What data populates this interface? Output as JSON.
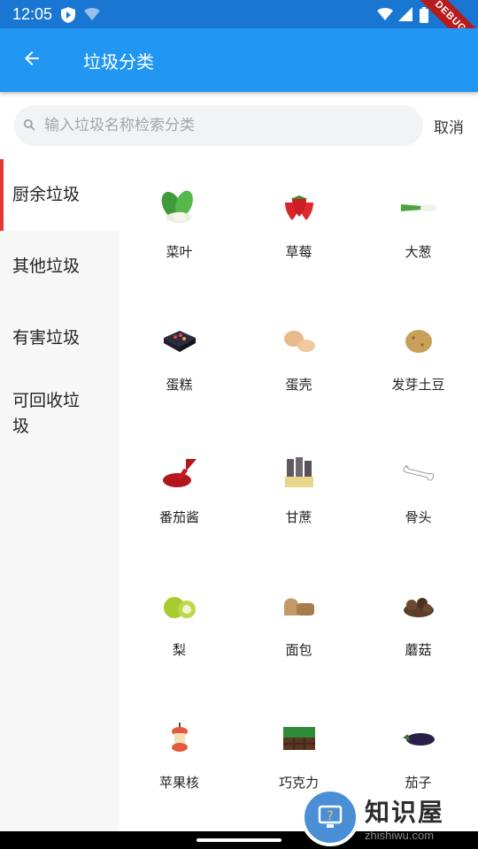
{
  "status_bar": {
    "time": "12:05",
    "debug_label": "DEBUG"
  },
  "app_bar": {
    "title": "垃圾分类"
  },
  "search": {
    "placeholder": "输入垃圾名称检索分类",
    "cancel_label": "取消"
  },
  "sidebar": {
    "items": [
      {
        "label": "厨余垃圾",
        "active": true
      },
      {
        "label": "其他垃圾",
        "active": false
      },
      {
        "label": "有害垃圾",
        "active": false
      },
      {
        "label": "可回收垃圾",
        "active": false
      }
    ]
  },
  "grid": {
    "items": [
      {
        "label": "菜叶",
        "icon": "vegetable-leaf-icon"
      },
      {
        "label": "草莓",
        "icon": "strawberry-icon"
      },
      {
        "label": "大葱",
        "icon": "scallion-icon"
      },
      {
        "label": "蛋糕",
        "icon": "cake-icon"
      },
      {
        "label": "蛋壳",
        "icon": "eggshell-icon"
      },
      {
        "label": "发芽土豆",
        "icon": "sprouted-potato-icon"
      },
      {
        "label": "番茄酱",
        "icon": "ketchup-icon"
      },
      {
        "label": "甘蔗",
        "icon": "sugarcane-icon"
      },
      {
        "label": "骨头",
        "icon": "bone-icon"
      },
      {
        "label": "梨",
        "icon": "pear-icon"
      },
      {
        "label": "面包",
        "icon": "bread-icon"
      },
      {
        "label": "蘑菇",
        "icon": "mushroom-icon"
      },
      {
        "label": "苹果核",
        "icon": "apple-core-icon"
      },
      {
        "label": "巧克力",
        "icon": "chocolate-icon"
      },
      {
        "label": "茄子",
        "icon": "eggplant-icon"
      }
    ]
  },
  "watermark": {
    "title": "知识屋",
    "subtitle": "zhishiwu.com"
  },
  "colors": {
    "status_bar": "#1976d2",
    "app_bar": "#2196f3",
    "active_indicator": "#e53935"
  }
}
